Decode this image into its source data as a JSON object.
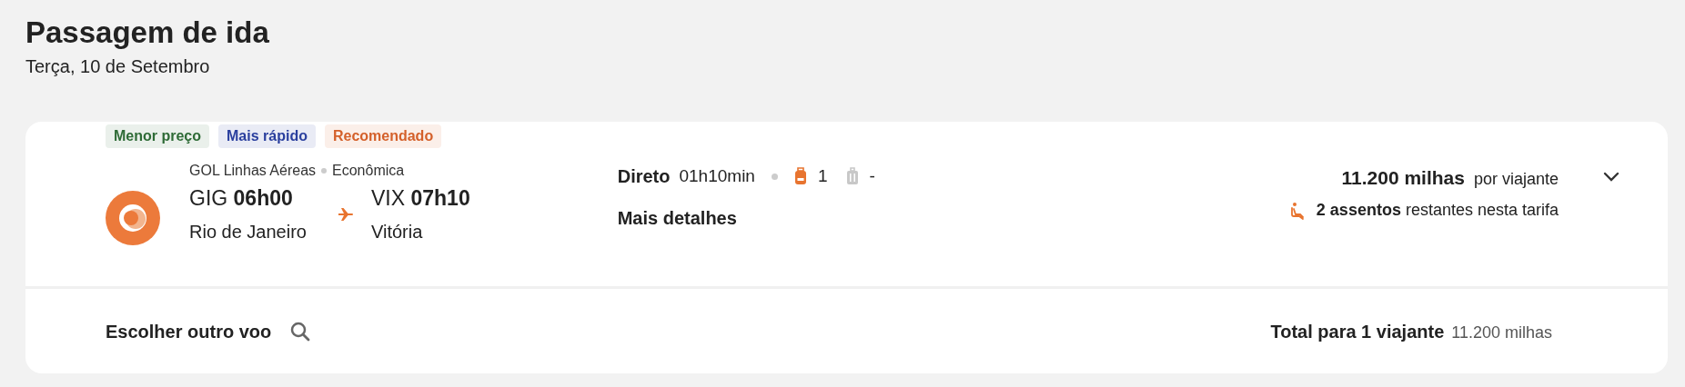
{
  "header": {
    "title": "Passagem de ida",
    "date": "Terça, 10 de Setembro"
  },
  "flight": {
    "tags": [
      {
        "label": "Menor preço",
        "color": "#2e6b36"
      },
      {
        "label": "Mais rápido",
        "color": "#2a3f9e"
      },
      {
        "label": "Recomendado",
        "color": "#d4602a"
      }
    ],
    "airline": "GOL Linhas Aéreas",
    "cabin": "Econômica",
    "departure": {
      "code": "GIG",
      "time": "06h00",
      "city": "Rio de Janeiro"
    },
    "arrival": {
      "code": "VIX",
      "time": "07h10",
      "city": "Vitória"
    },
    "stops": "Direto",
    "duration": "01h10min",
    "baggage": [
      {
        "kind": "backpack",
        "count": "1",
        "included": true
      },
      {
        "kind": "suitcase",
        "count": "-",
        "included": false
      }
    ],
    "details_link": "Mais detalhes",
    "price": "11.200 milhas",
    "price_unit": "por viajante",
    "seats": "**2 assentos** restantes nesta tarifa",
    "expanded": false
  },
  "footer": {
    "change_flight": "Escolher outro voo",
    "total_label": "Total para 1 viajante",
    "total_value": "11.200 milhas"
  }
}
